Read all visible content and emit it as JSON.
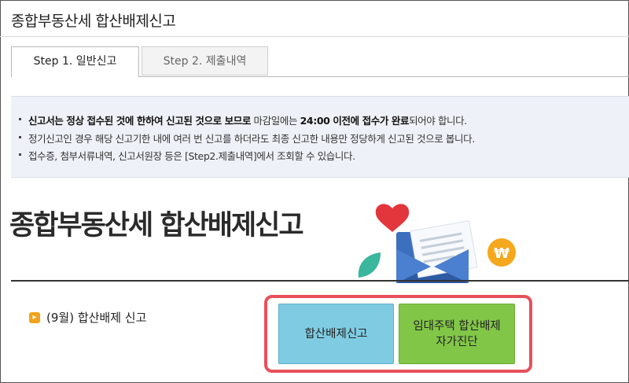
{
  "page": {
    "title": "종합부동산세 합산배제신고"
  },
  "tabs": [
    {
      "label": "Step 1. 일반신고",
      "active": true
    },
    {
      "label": "Step 2. 제출내역",
      "active": false
    }
  ],
  "notice": {
    "line1_bold_a": "신고서는 정상 접수된 것에 한하여 신고된 것으로 보므로",
    "line1_normal_a": " 마감일에는 ",
    "line1_bold_b": "24:00 이전에 접수가 완료",
    "line1_normal_b": "되어야 합니다.",
    "line2": "정기신고인 경우 해당 신고기한 내에 여러 번 신고를 하더라도 최종 신고한 내용만 정당하게 신고된 것으로 봅니다.",
    "line3": "접수증, 첨부서류내역, 신고서원장 등은 [Step2.제출내역]에서 조회할 수 있습니다."
  },
  "banner": {
    "title": "종합부동산세 합산배제신고"
  },
  "section": {
    "label": "(9월) 합산배제 신고"
  },
  "buttons": {
    "report": "합산배제신고",
    "self_check": "임대주택 합산배제\n자가진단"
  },
  "colors": {
    "highlight_border": "#e8505c",
    "report_button": "#7fcce2",
    "self_check_button": "#82c648",
    "notice_background": "#eef2f8",
    "bullet_arrow": "#f2a21b"
  }
}
